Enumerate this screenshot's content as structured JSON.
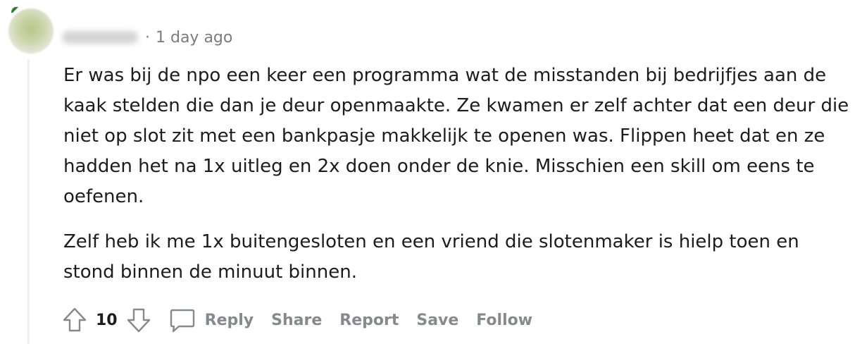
{
  "comment": {
    "timestamp": "1 day ago",
    "separator": "·",
    "paragraphs": [
      "Er was bij de npo een keer een programma wat de misstanden bij bedrijfjes aan de kaak stelden die dan je deur openmaakte. Ze kwamen er zelf achter dat een deur die niet op slot zit met een bankpasje makkelijk te openen was. Flippen heet dat en ze hadden het na 1x uitleg en 2x doen onder de knie. Misschien een skill om eens te oefenen.",
      "Zelf heb ik me 1x buitengesloten en een vriend die slotenmaker is hielp toen en stond binnen de minuut binnen."
    ]
  },
  "actions": {
    "vote_count": "10",
    "reply": "Reply",
    "share": "Share",
    "report": "Report",
    "save": "Save",
    "follow": "Follow"
  },
  "icons": {
    "upvote": "arrow-up-outline-icon",
    "downvote": "arrow-down-outline-icon",
    "comment": "speech-bubble-icon"
  },
  "colors": {
    "text": "#1c1c1c",
    "muted": "#878a8c",
    "thread_line": "#edeff1"
  }
}
